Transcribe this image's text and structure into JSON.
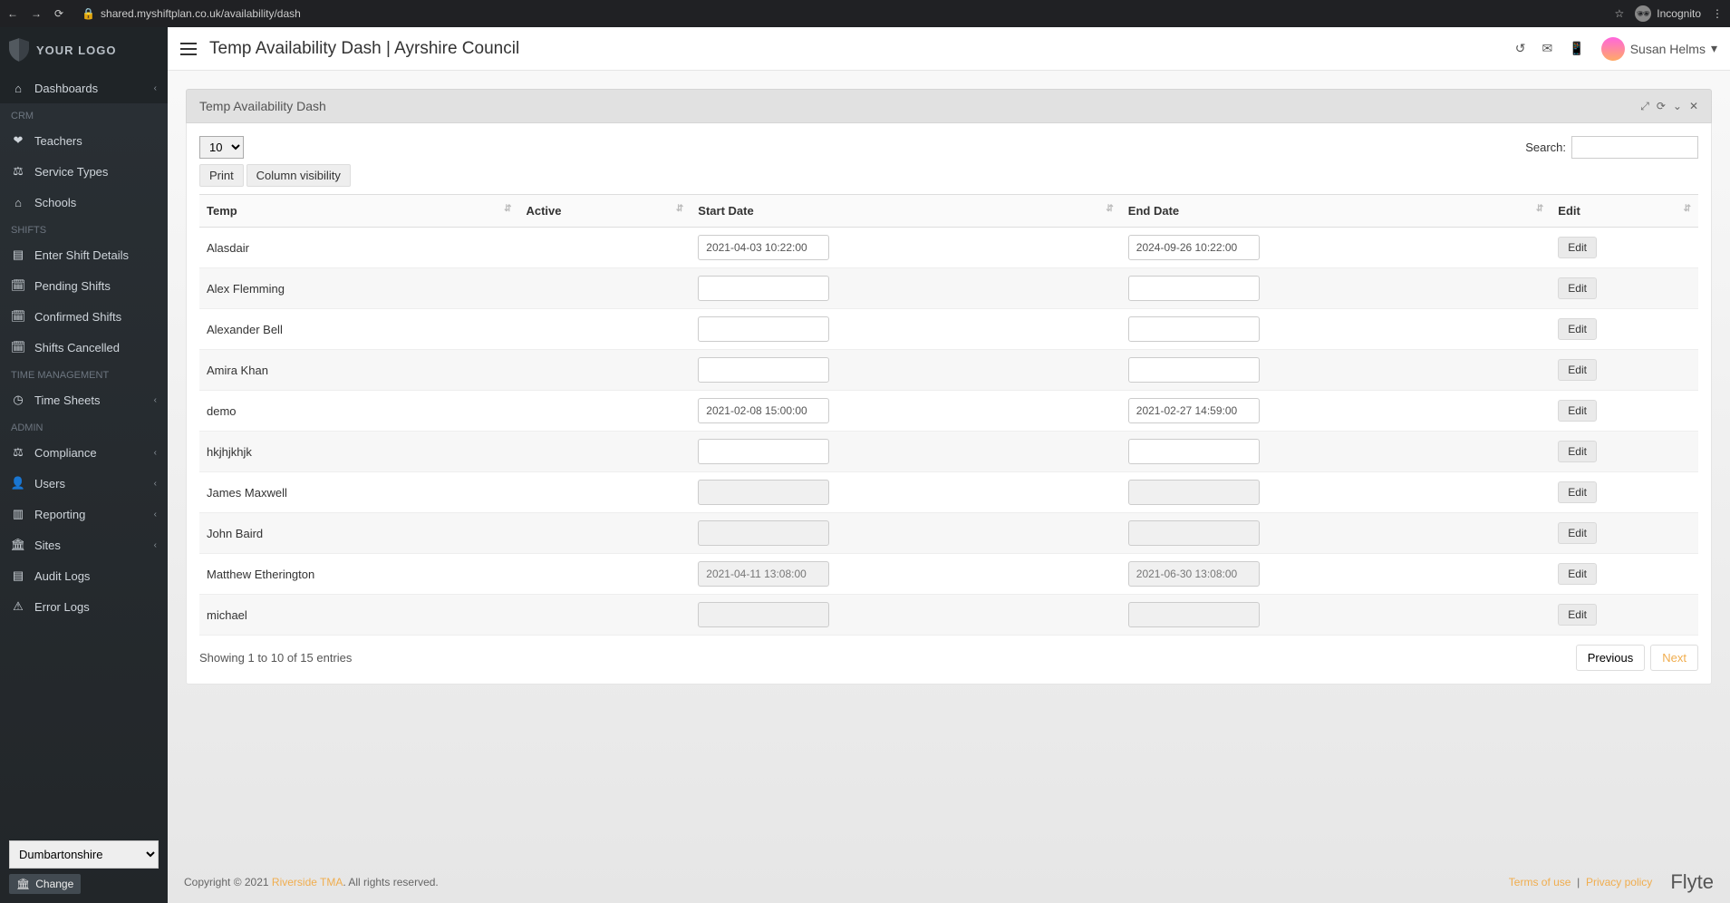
{
  "browser": {
    "url": "shared.myshiftplan.co.uk/availability/dash",
    "incognito_label": "Incognito"
  },
  "logo_text": "YOUR LOGO",
  "sidebar": {
    "dashboards": "Dashboards",
    "section_crm": "CRM",
    "teachers": "Teachers",
    "service_types": "Service Types",
    "schools": "Schools",
    "section_shifts": "SHIFTS",
    "enter_shift": "Enter Shift Details",
    "pending_shifts": "Pending Shifts",
    "confirmed_shifts": "Confirmed Shifts",
    "shifts_cancelled": "Shifts Cancelled",
    "section_time": "TIME MANAGEMENT",
    "time_sheets": "Time Sheets",
    "section_admin": "ADMIN",
    "compliance": "Compliance",
    "users": "Users",
    "reporting": "Reporting",
    "sites": "Sites",
    "audit_logs": "Audit Logs",
    "error_logs": "Error Logs",
    "region_selected": "Dumbartonshire",
    "change_label": "Change"
  },
  "header": {
    "title": "Temp Availability Dash | Ayrshire Council",
    "user_name": "Susan Helms"
  },
  "panel": {
    "title": "Temp Availability Dash",
    "length_value": "10",
    "search_label": "Search:",
    "print_label": "Print",
    "colvis_label": "Column visibility",
    "columns": {
      "temp": "Temp",
      "active": "Active",
      "start": "Start Date",
      "end": "End Date",
      "edit": "Edit"
    },
    "rows": [
      {
        "temp": "Alasdair",
        "start": "2021-04-03 10:22:00",
        "end": "2024-09-26 10:22:00",
        "disabled": false
      },
      {
        "temp": "Alex Flemming",
        "start": "",
        "end": "",
        "disabled": false
      },
      {
        "temp": "Alexander Bell",
        "start": "",
        "end": "",
        "disabled": false
      },
      {
        "temp": "Amira Khan",
        "start": "",
        "end": "",
        "disabled": false
      },
      {
        "temp": "demo",
        "start": "2021-02-08 15:00:00",
        "end": "2021-02-27 14:59:00",
        "disabled": false
      },
      {
        "temp": "hkjhjkhjk",
        "start": "",
        "end": "",
        "disabled": false
      },
      {
        "temp": "James Maxwell",
        "start": "",
        "end": "",
        "disabled": true
      },
      {
        "temp": "John Baird",
        "start": "",
        "end": "",
        "disabled": true
      },
      {
        "temp": "Matthew Etherington",
        "start": "2021-04-11 13:08:00",
        "end": "2021-06-30 13:08:00",
        "disabled": true
      },
      {
        "temp": "michael",
        "start": "",
        "end": "",
        "disabled": true
      }
    ],
    "edit_label": "Edit",
    "info": "Showing 1 to 10 of 15 entries",
    "prev_label": "Previous",
    "next_label": "Next"
  },
  "footer": {
    "copyright_prefix": "Copyright © 2021 ",
    "copyright_link": "Riverside TMA",
    "copyright_suffix": ". All rights reserved.",
    "terms": "Terms of use",
    "privacy": "Privacy policy",
    "brand": "Flyte"
  }
}
